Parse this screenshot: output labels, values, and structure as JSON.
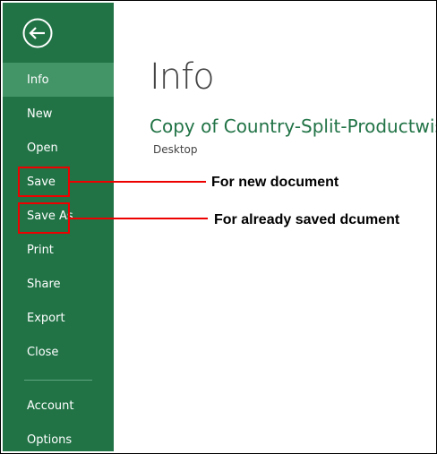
{
  "sidebar": {
    "back_icon": "back-arrow-icon",
    "items": [
      {
        "label": "Info",
        "active": true
      },
      {
        "label": "New"
      },
      {
        "label": "Open"
      },
      {
        "label": "Save"
      },
      {
        "label": "Save As"
      },
      {
        "label": "Print"
      },
      {
        "label": "Share"
      },
      {
        "label": "Export"
      },
      {
        "label": "Close"
      },
      {
        "label": "Account"
      },
      {
        "label": "Options"
      }
    ]
  },
  "main": {
    "title": "Info",
    "document_name": "Copy of Country-Split-Productwise",
    "location": "Desktop"
  },
  "annotations": {
    "save_note": "For new document",
    "save_as_note": "For already saved dcument"
  },
  "colors": {
    "sidebar_bg": "#217346",
    "active_item_bg": "#439467",
    "highlight": "#e00000"
  }
}
